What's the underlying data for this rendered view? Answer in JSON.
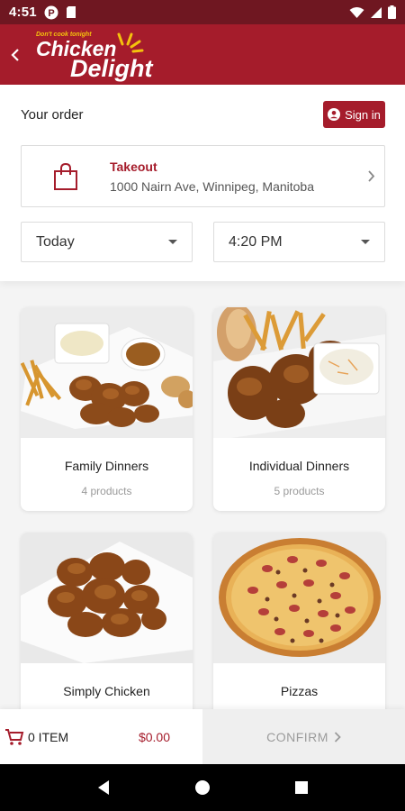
{
  "status_bar": {
    "time": "4:51"
  },
  "header": {
    "logo_tagline": "Don't cook tonight",
    "logo_line1": "Chicken",
    "logo_line2": "Delight"
  },
  "order": {
    "title": "Your order",
    "signin_label": "Sign in",
    "mode": "Takeout",
    "address": "1000 Nairn Ave, Winnipeg, Manitoba",
    "day": "Today",
    "time": "4:20 PM"
  },
  "categories": [
    {
      "name": "Family Dinners",
      "count": "4 products"
    },
    {
      "name": "Individual Dinners",
      "count": "5 products"
    },
    {
      "name": "Simply Chicken",
      "count": ""
    },
    {
      "name": "Pizzas",
      "count": ""
    }
  ],
  "cart": {
    "items_label": "0 ITEM",
    "total": "$0.00",
    "confirm_label": "CONFIRM"
  },
  "colors": {
    "brand": "#a51c2b",
    "status": "#6f1721"
  }
}
